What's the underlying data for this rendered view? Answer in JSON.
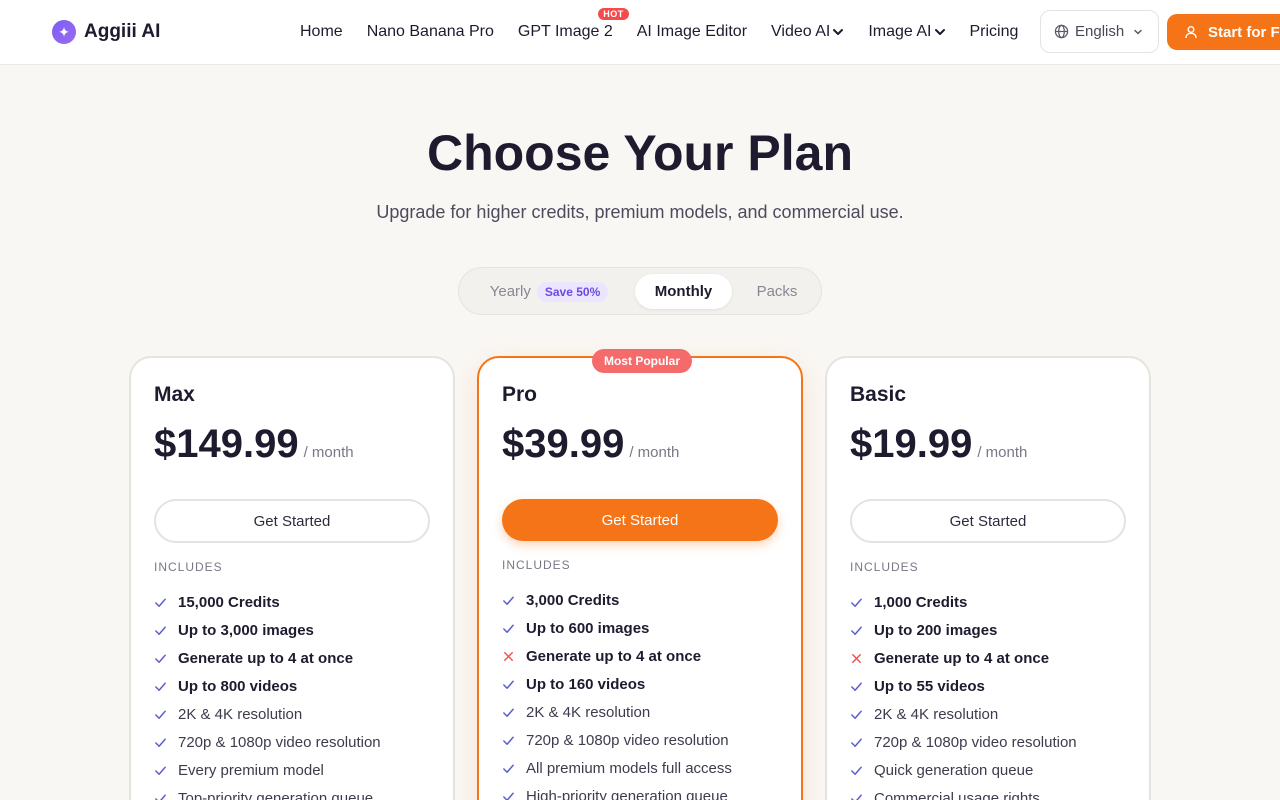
{
  "brand": {
    "name": "Aggiii AI",
    "accent": "#f57418",
    "purple": "#7c5cf5"
  },
  "nav": {
    "items": [
      {
        "label": "Home"
      },
      {
        "label": "Nano Banana Pro"
      },
      {
        "label": "GPT Image 2",
        "badge": "HOT"
      },
      {
        "label": "AI Image Editor"
      },
      {
        "label": "Video AI",
        "dropdown": true
      },
      {
        "label": "Image AI",
        "dropdown": true
      },
      {
        "label": "Pricing"
      }
    ],
    "language": "English",
    "start_label": "Start for Fr"
  },
  "hero": {
    "title": "Choose Your Plan",
    "subtitle": "Upgrade for higher credits, premium models, and commercial use."
  },
  "billing_toggle": {
    "yearly": "Yearly",
    "save_badge": "Save 50%",
    "monthly": "Monthly",
    "packs": "Packs",
    "selected": "Monthly"
  },
  "plans": [
    {
      "name": "Max",
      "price": "$149.99",
      "period": "/ month",
      "cta": "Get Started",
      "includes": "INCLUDES",
      "features": [
        {
          "text": "15,000 Credits",
          "included": true,
          "strong": true
        },
        {
          "text": "Up to 3,000 images",
          "included": true,
          "strong": true
        },
        {
          "text": "Generate up to 4 at once",
          "included": true,
          "strong": true
        },
        {
          "text": "Up to 800 videos",
          "included": true,
          "strong": true
        },
        {
          "text": "2K & 4K resolution",
          "included": true,
          "strong": false
        },
        {
          "text": "720p & 1080p video resolution",
          "included": true,
          "strong": false
        },
        {
          "text": "Every premium model",
          "included": true,
          "strong": false
        },
        {
          "text": "Top-priority generation queue",
          "included": true,
          "strong": false
        }
      ]
    },
    {
      "name": "Pro",
      "badge": "Most Popular",
      "price": "$39.99",
      "period": "/ month",
      "cta": "Get Started",
      "includes": "INCLUDES",
      "features": [
        {
          "text": "3,000 Credits",
          "included": true,
          "strong": true
        },
        {
          "text": "Up to 600 images",
          "included": true,
          "strong": true
        },
        {
          "text": "Generate up to 4 at once",
          "included": false,
          "strong": true
        },
        {
          "text": "Up to 160 videos",
          "included": true,
          "strong": true
        },
        {
          "text": "2K & 4K resolution",
          "included": true,
          "strong": false
        },
        {
          "text": "720p & 1080p video resolution",
          "included": true,
          "strong": false
        },
        {
          "text": "All premium models full access",
          "included": true,
          "strong": false
        },
        {
          "text": "High-priority generation queue",
          "included": true,
          "strong": false
        }
      ]
    },
    {
      "name": "Basic",
      "price": "$19.99",
      "period": "/ month",
      "cta": "Get Started",
      "includes": "INCLUDES",
      "features": [
        {
          "text": "1,000 Credits",
          "included": true,
          "strong": true
        },
        {
          "text": "Up to 200 images",
          "included": true,
          "strong": true
        },
        {
          "text": "Generate up to 4 at once",
          "included": false,
          "strong": true
        },
        {
          "text": "Up to 55 videos",
          "included": true,
          "strong": true
        },
        {
          "text": "2K & 4K resolution",
          "included": true,
          "strong": false
        },
        {
          "text": "720p & 1080p video resolution",
          "included": true,
          "strong": false
        },
        {
          "text": "Quick generation queue",
          "included": true,
          "strong": false
        },
        {
          "text": "Commercial usage rights",
          "included": true,
          "strong": false
        }
      ]
    }
  ]
}
